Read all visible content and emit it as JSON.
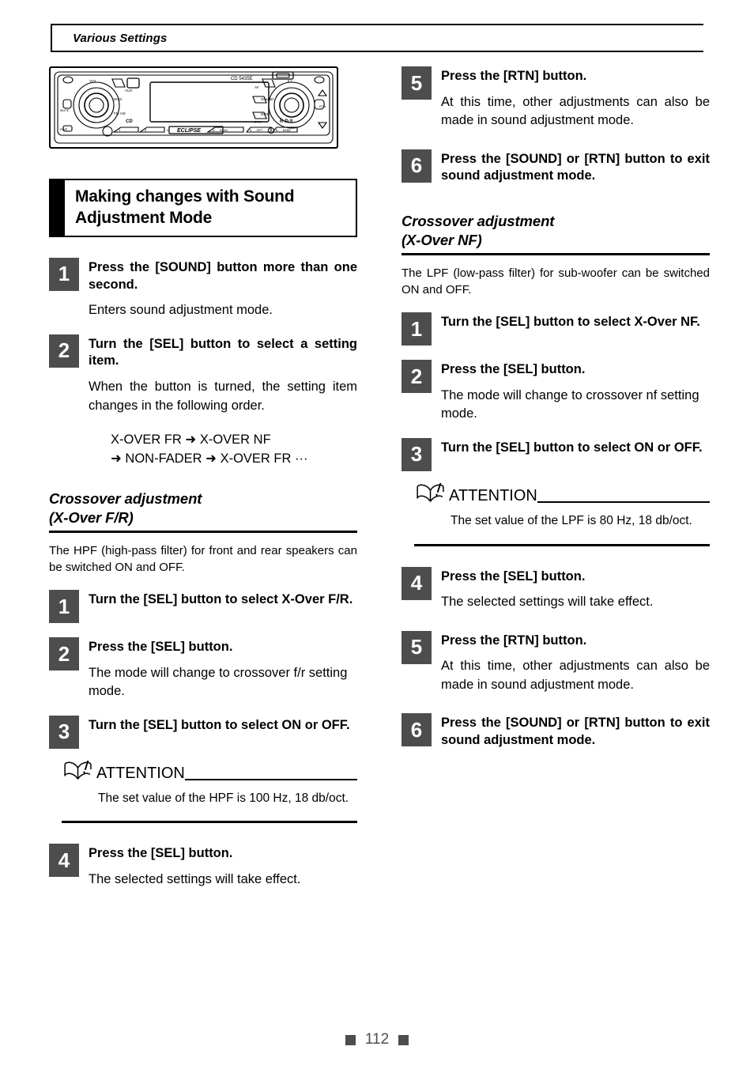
{
  "header": {
    "running_title": "Various Settings"
  },
  "figure": {
    "name": "car-audio-head-unit",
    "model_label": "CD 5435E",
    "brand_label": "ECLIPSE",
    "rds_label": "R·D·S",
    "labels": {
      "vol": "VOL",
      "aux": "AUX",
      "disc": "DISC",
      "fm_am": "FM AM",
      "mute": "MUTE",
      "pwr": "PWR",
      "ill": "ILL",
      "sound": "SOUND",
      "disp": "DISP",
      "pty": "PTY",
      "rtn": "RTN",
      "af": "AF",
      "preset1": "1",
      "preset2": "2",
      "preset3": "3",
      "preset4": "4",
      "preset5": "5",
      "preset6": "6",
      "scan": "SCAN",
      "rpt": "RPT",
      "band": "BAND"
    }
  },
  "section": {
    "title_line1": "Making changes with Sound",
    "title_line2": "Adjustment Mode"
  },
  "main_steps": [
    {
      "num": "1",
      "title": "Press the [SOUND] button more than one second.",
      "para": "Enters sound adjustment mode."
    },
    {
      "num": "2",
      "title": "Turn the [SEL] button to select a setting item.",
      "para": "When the button is turned, the setting item changes in the following order.",
      "sequence_line1": "X-OVER FR ➜ X-OVER NF",
      "sequence_line2": "➜ NON-FADER ➜ X-OVER FR ···"
    }
  ],
  "fr_section": {
    "heading_line1": "Crossover adjustment",
    "heading_line2": "(X-Over F/R)",
    "lead": "The HPF (high-pass filter) for front and rear speakers can be switched ON and OFF.",
    "steps": [
      {
        "num": "1",
        "title": "Turn the [SEL] button to select X-Over F/R."
      },
      {
        "num": "2",
        "title": "Press the [SEL] button.",
        "para": "The mode will change to crossover f/r setting mode."
      },
      {
        "num": "3",
        "title": "Turn the [SEL] button to select ON or OFF."
      },
      {
        "num": "4",
        "title": "Press the [SEL] button.",
        "para": "The selected settings will take effect."
      }
    ],
    "attention": {
      "label": "ATTENTION",
      "body": "The set value of the HPF is 100 Hz, 18 db/oct."
    }
  },
  "nf_section": {
    "heading_line1": "Crossover adjustment",
    "heading_line2": "(X-Over NF)",
    "lead": "The LPF (low-pass filter) for sub-woofer can be switched ON and OFF.",
    "steps": [
      {
        "num": "1",
        "title": "Turn the [SEL] button to select X-Over NF."
      },
      {
        "num": "2",
        "title": "Press the [SEL] button.",
        "para": "The mode will change to crossover nf setting mode."
      },
      {
        "num": "3",
        "title": "Turn the [SEL] button to select ON or OFF."
      },
      {
        "num": "4",
        "title": "Press the [SEL] button.",
        "para": "The selected settings will take effect."
      },
      {
        "num": "5",
        "title": "Press the [RTN] button.",
        "para": "At this time, other adjustments can also be made in sound adjustment mode."
      },
      {
        "num": "6",
        "title": "Press the [SOUND] or [RTN] button to exit sound adjustment mode."
      }
    ],
    "attention": {
      "label": "ATTENTION",
      "body": "The set value of the LPF is 80 Hz, 18 db/oct."
    }
  },
  "top_right_steps": [
    {
      "num": "5",
      "title": "Press the [RTN] button.",
      "para": "At this time, other adjustments can also be made in sound adjustment mode."
    },
    {
      "num": "6",
      "title": "Press the [SOUND] or [RTN] button to exit sound adjustment mode."
    }
  ],
  "footer": {
    "page_number": "112"
  },
  "colors": {
    "step_box": "#4d4d4d",
    "rule": "#000000",
    "page_background": "#ffffff"
  }
}
